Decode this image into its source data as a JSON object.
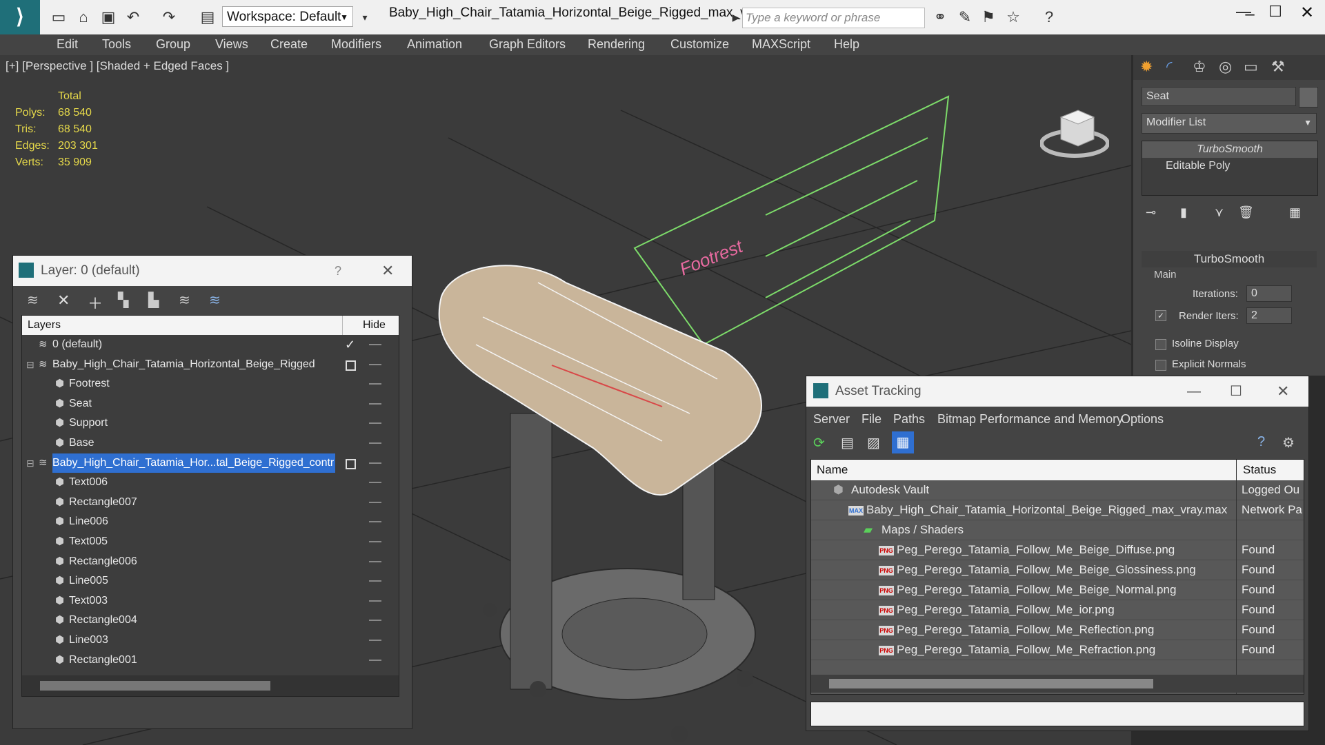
{
  "titlebar": {
    "workspace": "Workspace: Default",
    "file_title": "Baby_High_Chair_Tatamia_Horizontal_Beige_Rigged_max_vr...",
    "search_placeholder": "Type a keyword or phrase"
  },
  "menu": [
    "Edit",
    "Tools",
    "Group",
    "Views",
    "Create",
    "Modifiers",
    "Animation",
    "Graph Editors",
    "Rendering",
    "Customize",
    "MAXScript",
    "Help"
  ],
  "viewport": {
    "label": "[+] [Perspective ] [Shaded + Edged Faces ]",
    "stats_header": "Total",
    "stats": [
      {
        "k": "Polys:",
        "v": "68 540"
      },
      {
        "k": "Tris:",
        "v": "68 540"
      },
      {
        "k": "Edges:",
        "v": "203 301"
      },
      {
        "k": "Verts:",
        "v": "35 909"
      }
    ],
    "annotation": "Footrest"
  },
  "layer_dialog": {
    "title": "Layer: 0 (default)",
    "help": "?",
    "col_layers": "Layers",
    "col_hide": "Hide",
    "rows": [
      {
        "name": "0 (default)",
        "level": 0
      },
      {
        "name": "Baby_High_Chair_Tatamia_Horizontal_Beige_Rigged",
        "level": 0,
        "expander": "−"
      },
      {
        "name": "Footrest",
        "level": 1
      },
      {
        "name": "Seat",
        "level": 1
      },
      {
        "name": "Support",
        "level": 1
      },
      {
        "name": "Base",
        "level": 1
      },
      {
        "name": "Baby_High_Chair_Tatamia_Hor...tal_Beige_Rigged_contr",
        "level": 0,
        "expander": "−",
        "selected": true
      },
      {
        "name": "Text006",
        "level": 1
      },
      {
        "name": "Rectangle007",
        "level": 1
      },
      {
        "name": "Line006",
        "level": 1
      },
      {
        "name": "Text005",
        "level": 1
      },
      {
        "name": "Rectangle006",
        "level": 1
      },
      {
        "name": "Line005",
        "level": 1
      },
      {
        "name": "Text003",
        "level": 1
      },
      {
        "name": "Rectangle004",
        "level": 1
      },
      {
        "name": "Line003",
        "level": 1
      },
      {
        "name": "Rectangle001",
        "level": 1
      }
    ]
  },
  "command_panel": {
    "object_name": "Seat",
    "modifier_list": "Modifier List",
    "stack": [
      "TurboSmooth",
      "Editable Poly"
    ],
    "rollout_title": "TurboSmooth",
    "group_main": "Main",
    "iterations_label": "Iterations:",
    "iterations_value": "0",
    "render_iters_label": "Render Iters:",
    "render_iters_value": "2",
    "isoline_label": "Isoline Display",
    "explicit_label": "Explicit Normals"
  },
  "asset_tracking": {
    "title": "Asset Tracking",
    "menu": [
      "Server",
      "File",
      "Paths",
      "Bitmap Performance and Memory",
      "Options"
    ],
    "col_name": "Name",
    "col_status": "Status",
    "rows": [
      {
        "name": "Autodesk Vault",
        "status": "Logged Ou",
        "indent": 1,
        "icon": "vault"
      },
      {
        "name": "Baby_High_Chair_Tatamia_Horizontal_Beige_Rigged_max_vray.max",
        "status": "Network Pa",
        "indent": 2,
        "icon": "max"
      },
      {
        "name": "Maps / Shaders",
        "status": "",
        "indent": 3,
        "icon": "maps"
      },
      {
        "name": "Peg_Perego_Tatamia_Follow_Me_Beige_Diffuse.png",
        "status": "Found",
        "indent": 4,
        "icon": "png"
      },
      {
        "name": "Peg_Perego_Tatamia_Follow_Me_Beige_Glossiness.png",
        "status": "Found",
        "indent": 4,
        "icon": "png"
      },
      {
        "name": "Peg_Perego_Tatamia_Follow_Me_Beige_Normal.png",
        "status": "Found",
        "indent": 4,
        "icon": "png"
      },
      {
        "name": "Peg_Perego_Tatamia_Follow_Me_ior.png",
        "status": "Found",
        "indent": 4,
        "icon": "png"
      },
      {
        "name": "Peg_Perego_Tatamia_Follow_Me_Reflection.png",
        "status": "Found",
        "indent": 4,
        "icon": "png"
      },
      {
        "name": "Peg_Perego_Tatamia_Follow_Me_Refraction.png",
        "status": "Found",
        "indent": 4,
        "icon": "png"
      }
    ]
  },
  "colors": {
    "accent": "#2f6fd1",
    "stats": "#e5d84a",
    "teal": "#1f6f79"
  }
}
